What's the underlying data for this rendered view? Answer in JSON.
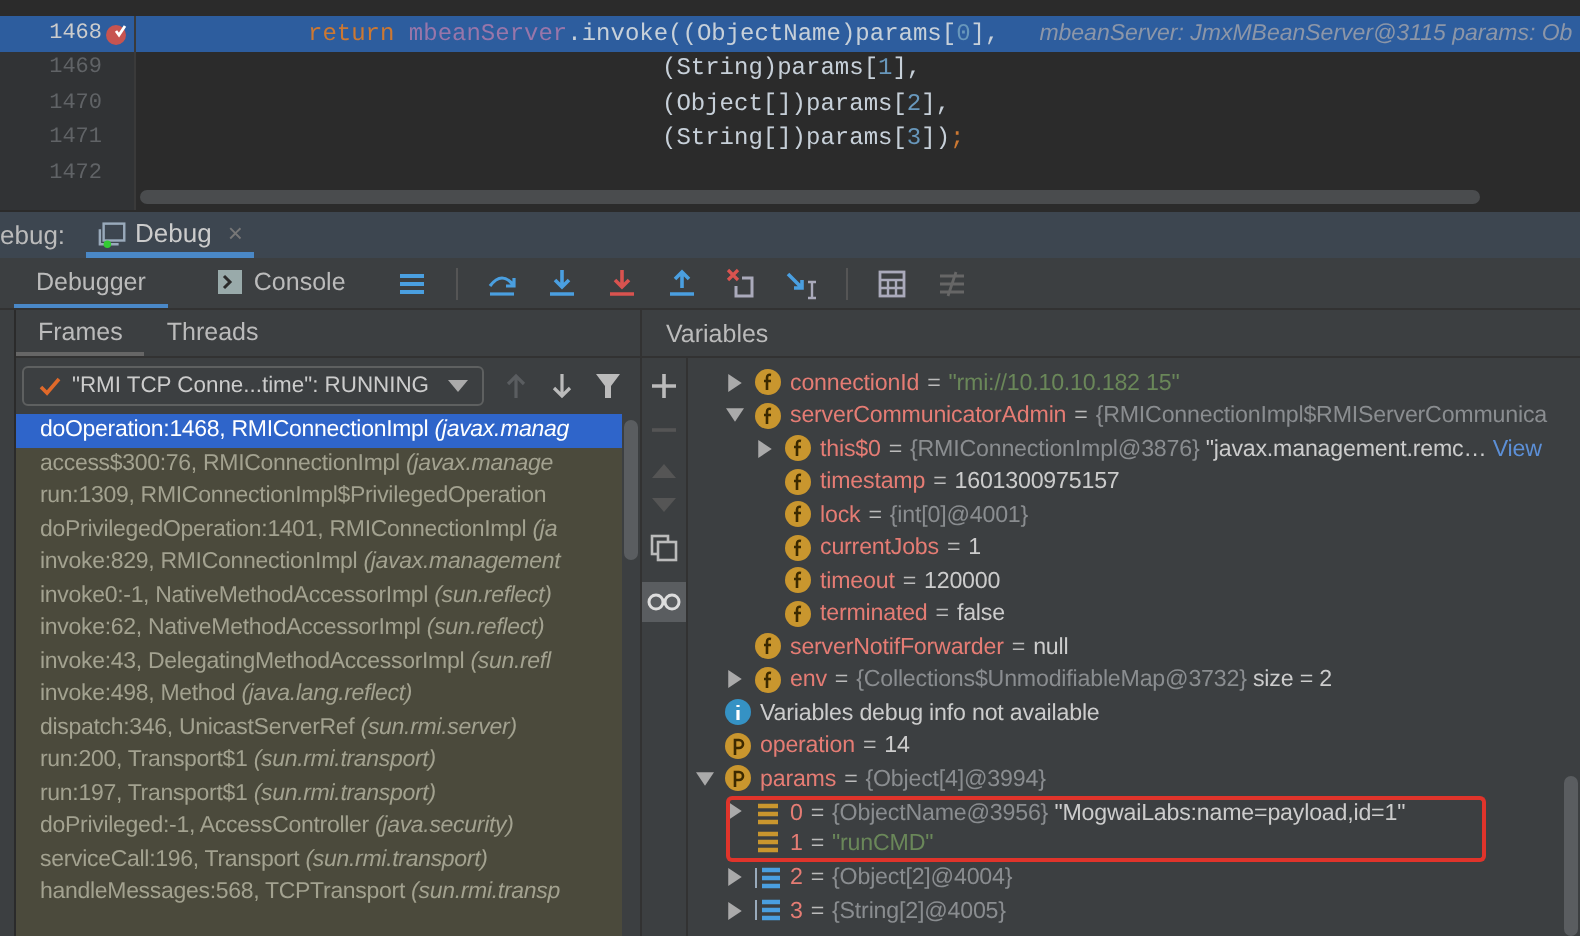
{
  "editor": {
    "lines": [
      {
        "number": "1468",
        "kind": "statement",
        "highlighted": true,
        "breakpoint": true,
        "segments": [
          {
            "text": "return ",
            "kind": "keyword"
          },
          {
            "text": "mbeanServer",
            "kind": "field"
          },
          {
            "text": ".invoke((ObjectName)params[",
            "kind": "plain"
          },
          {
            "text": "0",
            "kind": "number"
          },
          {
            "text": "],",
            "kind": "plain"
          }
        ],
        "hint": "mbeanServer: JmxMBeanServer@3115  params: Ob"
      },
      {
        "number": "1469",
        "kind": "continuation",
        "highlighted": false,
        "breakpoint": false,
        "segments": [
          {
            "text": "(String)params[",
            "kind": "plain"
          },
          {
            "text": "1",
            "kind": "number"
          },
          {
            "text": "],",
            "kind": "plain"
          }
        ]
      },
      {
        "number": "1470",
        "kind": "continuation",
        "highlighted": false,
        "breakpoint": false,
        "segments": [
          {
            "text": "(Object[])params[",
            "kind": "plain"
          },
          {
            "text": "2",
            "kind": "number"
          },
          {
            "text": "],",
            "kind": "plain"
          }
        ]
      },
      {
        "number": "1471",
        "kind": "continuation",
        "highlighted": false,
        "breakpoint": false,
        "segments": [
          {
            "text": "(String[])params[",
            "kind": "plain"
          },
          {
            "text": "3",
            "kind": "number"
          },
          {
            "text": "])",
            "kind": "plain"
          },
          {
            "text": ";",
            "kind": "keyword"
          }
        ]
      },
      {
        "number": "1472",
        "kind": "continuation",
        "highlighted": false,
        "breakpoint": false
      }
    ]
  },
  "debug_bar": {
    "label": "ebug:",
    "tab": {
      "label": "Debug",
      "close": "×"
    }
  },
  "toolbar": {
    "tabs": [
      {
        "label": "Debugger",
        "selected": true
      },
      {
        "label": "Console",
        "selected": false
      }
    ]
  },
  "frames_panel": {
    "tabs": [
      {
        "label": "Frames",
        "selected": true
      },
      {
        "label": "Threads",
        "selected": false
      }
    ],
    "thread": "\"RMI TCP Conne...time\": RUNNING",
    "frames": [
      {
        "method": "doOperation:1468, RMIConnectionImpl",
        "package": "(javax.manag",
        "selected": true
      },
      {
        "method": "access$300:76, RMIConnectionImpl",
        "package": "(javax.manage",
        "selected": false
      },
      {
        "method": "run:1309, RMIConnectionImpl$PrivilegedOperation",
        "selected": false
      },
      {
        "method": "doPrivilegedOperation:1401, RMIConnectionImpl",
        "package": "(ja",
        "selected": false
      },
      {
        "method": "invoke:829, RMIConnectionImpl",
        "package": "(javax.management",
        "selected": false
      },
      {
        "method": "invoke0:-1, NativeMethodAccessorImpl",
        "package": "(sun.reflect)",
        "selected": false
      },
      {
        "method": "invoke:62, NativeMethodAccessorImpl",
        "package": "(sun.reflect)",
        "selected": false
      },
      {
        "method": "invoke:43, DelegatingMethodAccessorImpl",
        "package": "(sun.refl",
        "selected": false
      },
      {
        "method": "invoke:498, Method",
        "package": "(java.lang.reflect)",
        "selected": false
      },
      {
        "method": "dispatch:346, UnicastServerRef",
        "package": "(sun.rmi.server)",
        "selected": false
      },
      {
        "method": "run:200, Transport$1",
        "package": "(sun.rmi.transport)",
        "selected": false
      },
      {
        "method": "run:197, Transport$1",
        "package": "(sun.rmi.transport)",
        "selected": false
      },
      {
        "method": "doPrivileged:-1, AccessController",
        "package": "(java.security)",
        "selected": false
      },
      {
        "method": "serviceCall:196, Transport",
        "package": "(sun.rmi.transport)",
        "selected": false
      },
      {
        "method": "handleMessages:568, TCPTransport",
        "package": "(sun.rmi.transp",
        "selected": false
      }
    ]
  },
  "variables": {
    "title": "Variables",
    "continued_items": [
      {
        "kind": "field",
        "name": "connectionId",
        "sign": "=",
        "expanded": false,
        "value": [
          {
            "text": "\"rmi://10.10.10.182  15\"",
            "kind": "string"
          }
        ]
      },
      {
        "kind": "field",
        "name": "serverCommunicatorAdmin",
        "sign": "=",
        "expanded": true,
        "value": [
          {
            "text": "{RMIConnectionImpl$RMIServerCommunica",
            "kind": "ref"
          }
        ],
        "children": [
          {
            "kind": "field",
            "name": "this$0",
            "sign": "=",
            "expanded": false,
            "value": [
              {
                "text": "{RMIConnectionImpl@3876}",
                "kind": "ref"
              },
              {
                "text": " \"javax.management.remc…",
                "kind": "plain"
              },
              {
                "text": " View",
                "kind": "link"
              }
            ]
          },
          {
            "kind": "field",
            "name": "timestamp",
            "sign": "=",
            "value": [
              {
                "text": "1601300975157",
                "kind": "plain"
              }
            ]
          },
          {
            "kind": "field",
            "name": "lock",
            "sign": "=",
            "value": [
              {
                "text": "{int[0]@4001}",
                "kind": "ref"
              }
            ]
          },
          {
            "kind": "field",
            "name": "currentJobs",
            "sign": "=",
            "value": [
              {
                "text": "1",
                "kind": "plain"
              }
            ]
          },
          {
            "kind": "field",
            "name": "timeout",
            "sign": "=",
            "value": [
              {
                "text": "120000",
                "kind": "plain"
              }
            ]
          },
          {
            "kind": "field",
            "name": "terminated",
            "sign": "=",
            "value": [
              {
                "text": "false",
                "kind": "plain"
              }
            ]
          }
        ]
      },
      {
        "kind": "field",
        "name": "serverNotifForwarder",
        "sign": "=",
        "value": [
          {
            "text": "null",
            "kind": "plain"
          }
        ]
      },
      {
        "kind": "field",
        "name": "env",
        "sign": "=",
        "expanded": false,
        "value": [
          {
            "text": "{Collections$UnmodifiableMap@3732}",
            "kind": "ref"
          },
          {
            "text": "  size = 2",
            "kind": "plain"
          }
        ]
      }
    ],
    "items": [
      {
        "kind": "info",
        "name": "Variables debug info not available"
      },
      {
        "kind": "param",
        "name": "operation",
        "sign": "=",
        "value": [
          {
            "text": "14",
            "kind": "plain"
          }
        ]
      },
      {
        "kind": "param",
        "name": "params",
        "sign": "=",
        "expanded": true,
        "value": [
          {
            "text": "{Object[4]@3994}",
            "kind": "ref"
          }
        ],
        "children": [
          {
            "kind": "element",
            "name": "0",
            "sign": "=",
            "expanded": false,
            "annotated": true,
            "value": [
              {
                "text": "{ObjectName@3956}",
                "kind": "ref"
              },
              {
                "text": " \"MogwaiLabs:name=payload,id=1\"",
                "kind": "plain"
              }
            ]
          },
          {
            "kind": "element",
            "name": "1",
            "sign": "=",
            "annotated": true,
            "value": [
              {
                "text": "\"runCMD\"",
                "kind": "string"
              }
            ]
          },
          {
            "kind": "array",
            "name": "2",
            "sign": "=",
            "expanded": false,
            "annotated": false,
            "value": [
              {
                "text": "{Object[2]@4004}",
                "kind": "ref"
              }
            ]
          },
          {
            "kind": "array",
            "name": "3",
            "sign": "=",
            "expanded": false,
            "annotated": false,
            "value": [
              {
                "text": "{String[2]@4005}",
                "kind": "ref"
              }
            ]
          }
        ]
      }
    ]
  }
}
